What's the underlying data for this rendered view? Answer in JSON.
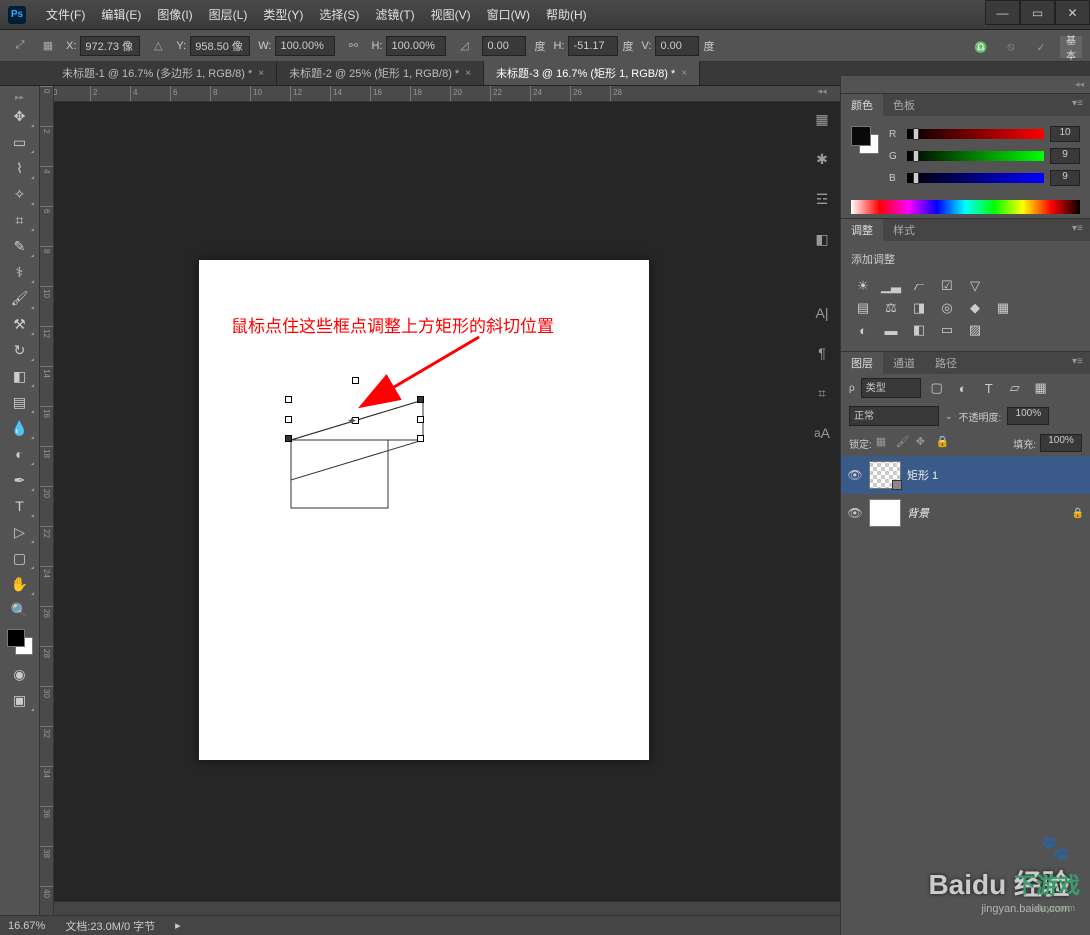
{
  "menu": [
    "文件(F)",
    "编辑(E)",
    "图像(I)",
    "图层(L)",
    "类型(Y)",
    "选择(S)",
    "滤镜(T)",
    "视图(V)",
    "窗口(W)",
    "帮助(H)"
  ],
  "options": {
    "x_label": "X:",
    "x": "972.73 像",
    "y_label": "Y:",
    "y": "958.50 像",
    "w_label": "W:",
    "w": "100.00%",
    "h_label": "H:",
    "h": "100.00%",
    "angle": "0.00",
    "angle_unit": "度",
    "h2_label": "H:",
    "h2": "-51.17",
    "h2_unit": "度",
    "v_label": "V:",
    "v": "0.00",
    "v_unit": "度",
    "basic": "基本"
  },
  "tabs": [
    {
      "label": "未标题-1 @ 16.7% (多边形 1, RGB/8) *"
    },
    {
      "label": "未标题-2 @ 25% (矩形 1, RGB/8) *"
    },
    {
      "label": "未标题-3 @ 16.7% (矩形 1, RGB/8) *"
    }
  ],
  "ruler_h": [
    "0",
    "2",
    "4",
    "6",
    "8",
    "10",
    "12",
    "14",
    "16",
    "18",
    "20",
    "22",
    "24",
    "26",
    "28"
  ],
  "ruler_v": [
    "0",
    "2",
    "4",
    "6",
    "8",
    "10",
    "12",
    "14",
    "16",
    "18",
    "20",
    "22",
    "24",
    "26",
    "28",
    "30",
    "32",
    "34",
    "36",
    "38",
    "40"
  ],
  "annotation": "鼠标点住这些框点调整上方矩形的斜切位置",
  "panels": {
    "color_tab": "颜色",
    "swatch_tab": "色板",
    "rgb": {
      "r_label": "R",
      "r": "10",
      "g_label": "G",
      "g": "9",
      "b_label": "B",
      "b": "9"
    },
    "adjust_tab": "调整",
    "styles_tab": "样式",
    "adjust_title": "添加调整",
    "layers_tab": "图层",
    "channels_tab": "通道",
    "paths_tab": "路径",
    "filter_label": "类型",
    "blend": "正常",
    "opacity_label": "不透明度:",
    "opacity": "100%",
    "lock_label": "锁定:",
    "fill_label": "填充:",
    "fill": "100%",
    "layer1": "矩形 1",
    "layer_bg": "背景"
  },
  "status": {
    "zoom": "16.67%",
    "doc": "文档:23.0M/0 字节"
  },
  "watermark": {
    "line1": "Baidu 经验",
    "line2": "jingyan.baidu.com",
    "brand": "下游戏",
    "site": "xiayx.com"
  }
}
